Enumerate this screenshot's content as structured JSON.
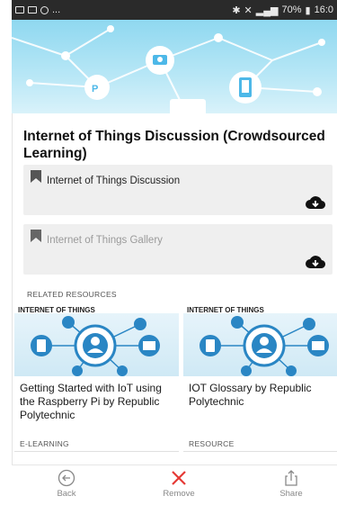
{
  "status_bar": {
    "left_icons": [
      "image-icon",
      "image-icon",
      "whatsapp-icon"
    ],
    "ellipsis": "...",
    "battery": "70%",
    "time": "16:0"
  },
  "hero": {
    "image": "iot-network-banner"
  },
  "page": {
    "title": "Internet of Things Discussion (Crowdsourced Learning)"
  },
  "resources": [
    {
      "label": "Internet of Things Discussion",
      "enabled": true,
      "icon": "bookmark-icon",
      "action_icon": "cloud-download-icon"
    },
    {
      "label": "Internet of Things Gallery",
      "enabled": false,
      "icon": "bookmark-icon",
      "action_icon": "cloud-download-icon"
    }
  ],
  "related": {
    "heading": "RELATED RESOURCES",
    "items": [
      {
        "title": "Getting Started with IoT using the Raspberry Pi by Republic Polytechnic",
        "type": "E-LEARNING",
        "thumb_text": "INTERNET OF THINGS"
      },
      {
        "title": "IOT Glossary by Republic Polytechnic",
        "type": "RESOURCE",
        "thumb_text": "INTERNET OF THINGS"
      }
    ]
  },
  "actions": {
    "back": "Back",
    "remove": "Remove",
    "share": "Share"
  },
  "colors": {
    "accent_remove": "#e53935",
    "hero_blue": "#8fd8f0",
    "card_bg": "#efefef"
  }
}
